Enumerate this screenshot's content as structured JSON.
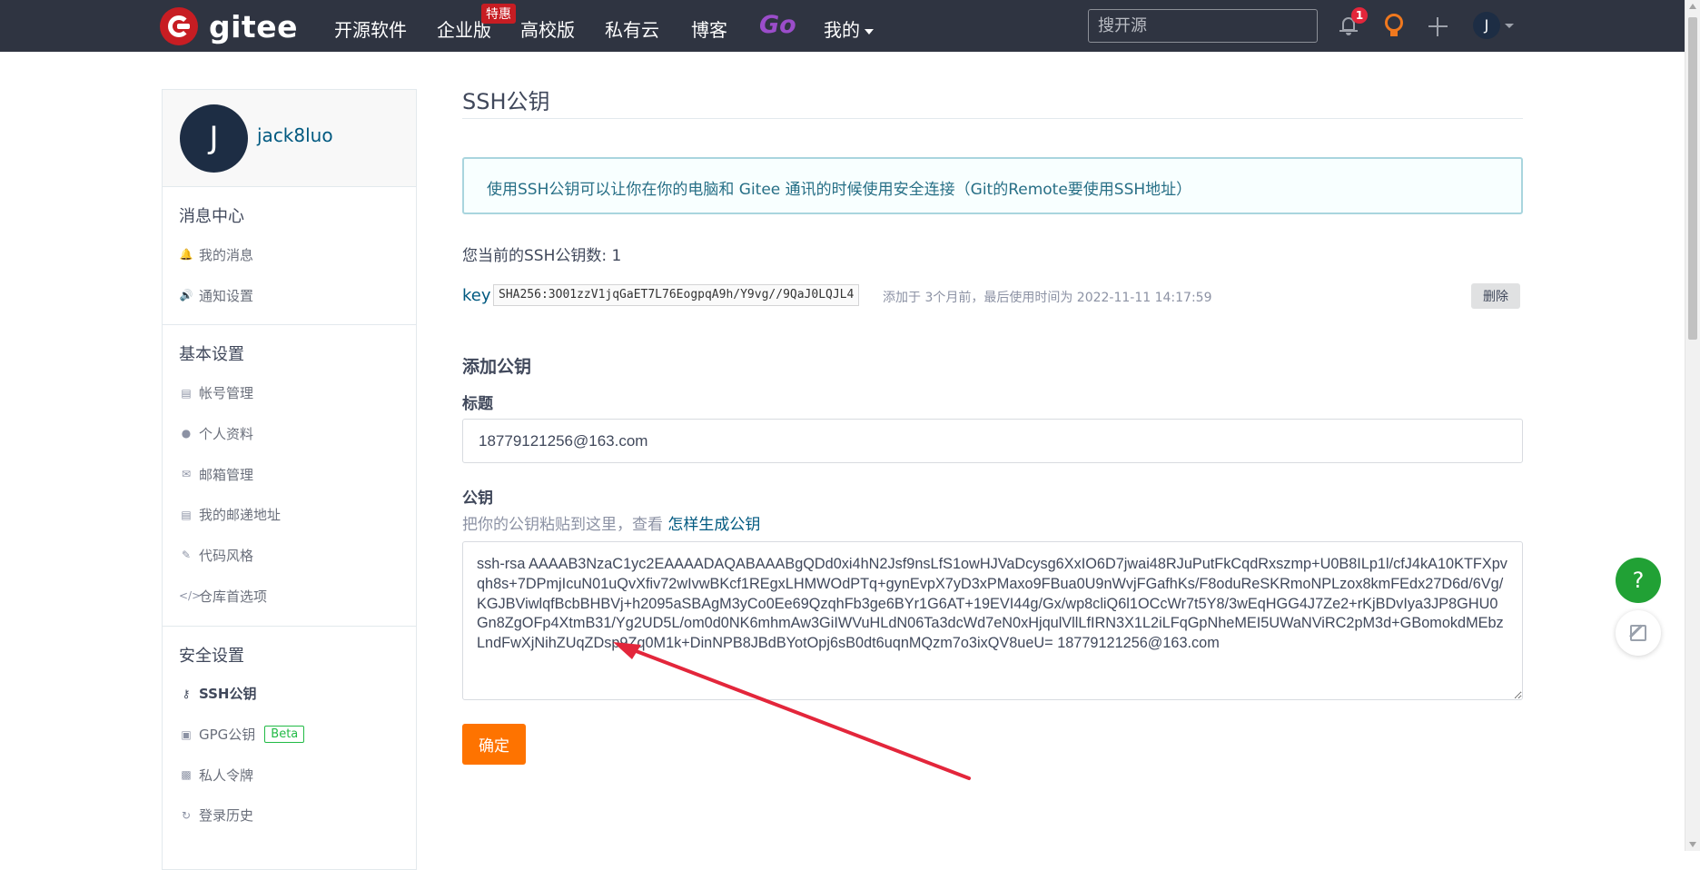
{
  "navbar": {
    "brand": "gitee",
    "items": [
      "开源软件",
      "企业版",
      "高校版",
      "私有云",
      "博客"
    ],
    "badge": "特惠",
    "go": "Go",
    "mine": "我的",
    "search_placeholder": "搜开源",
    "notification_count": "1",
    "avatar_letter": "J"
  },
  "sidebar": {
    "avatar_letter": "J",
    "username": "jack8luo",
    "groups": [
      {
        "title": "消息中心",
        "items": [
          "我的消息",
          "通知设置"
        ]
      },
      {
        "title": "基本设置",
        "items": [
          "帐号管理",
          "个人资料",
          "邮箱管理",
          "我的邮递地址",
          "代码风格",
          "仓库首选项"
        ]
      },
      {
        "title": "安全设置",
        "items": [
          "SSH公钥",
          "GPG公钥",
          "私人令牌",
          "登录历史"
        ]
      }
    ],
    "beta_label": "Beta"
  },
  "main": {
    "title": "SSH公钥",
    "info": "使用SSH公钥可以让你在你的电脑和 Gitee 通讯的时候使用安全连接（Git的Remote要使用SSH地址）",
    "key_count": "您当前的SSH公钥数: 1",
    "key": {
      "name": "key",
      "fingerprint": "SHA256:3O01zzV1jqGaET7L76EogpqA9h/Y9vg//9QaJ0LQJL4",
      "meta": "添加于 3个月前，最后使用时间为 2022-11-11 14:17:59",
      "delete_label": "删除"
    },
    "add_title": "添加公钥",
    "title_label": "标题",
    "title_value": "18779121256@163.com",
    "key_label": "公钥",
    "hint": "把你的公钥粘贴到这里，查看",
    "hint_link": "怎样生成公钥",
    "key_value": "ssh-rsa AAAAB3NzaC1yc2EAAAADAQABAAABgQDd0xi4hN2Jsf9nsLfS1owHJVaDcysg6XxIO6D7jwai48RJuPutFkCqdRxszmp+U0B8ILp1l/cfJ4kA10KTFXpvqh8s+7DPmjIcuN01uQvXfiv72wIvwBKcf1REgxLHMWOdPTq+gynEvpX7yD3xPMaxo9FBua0U9nWvjFGafhKs/F8oduReSKRmoNPLzox8kmFEdx27D6d/6Vg/KGJBViwlqfBcbBHBVj+h2095aSBAgM3yCo0Ee69QzqhFb3ge6BYr1G6AT+19EVI44g/Gx/wp8cliQ6l1OCcWr7t5Y8/3wEqHGG4J7Ze2+rKjBDvIya3JP8GHU0Gn8ZgOFp4XtmB31/Yg2UD5L/om0d0NK6mhmAw3GiIWVuHLdN06Ta3dcWd7eN0xHjqulVllLfIRN3X1L2iLFqGpNheMEI5UWaNViRC2pM3d+GBomokdMEbzLndFwXjNihZUqZDsp9Zq0M1k+DinNPB8JBdBYotOpj6sB0dt6uqnMQzm7o3ixQV8ueU= 18779121256@163.com",
    "submit_label": "确定"
  },
  "floating": {
    "help": "?"
  },
  "colors": {
    "navbar_bg": "#2f3441",
    "brand_red": "#c71d23",
    "submit": "#fe7300",
    "annotation_arrow": "#e3263b"
  }
}
